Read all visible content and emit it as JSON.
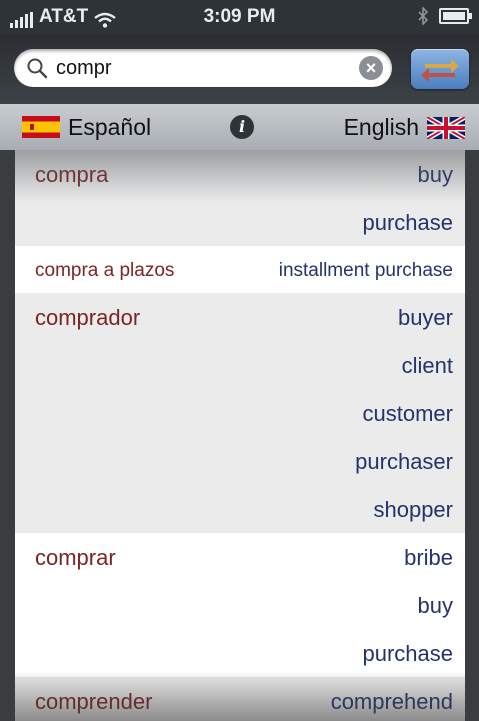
{
  "status_bar": {
    "carrier": "AT&T",
    "time": "3:09 PM"
  },
  "search": {
    "query": "compr"
  },
  "language_bar": {
    "source_language": "Español",
    "target_language": "English"
  },
  "colors": {
    "spanish_word": "#7b2424",
    "english_word": "#26326e",
    "swap_button": "#4b7fc0"
  },
  "results": [
    {
      "es": "compra",
      "en": "buy",
      "shade": "alt"
    },
    {
      "es": "",
      "en": "purchase",
      "shade": "alt"
    },
    {
      "es": "compra a plazos",
      "en": "installment purchase",
      "shade": "plain",
      "compact": true
    },
    {
      "es": "comprador",
      "en": "buyer",
      "shade": "alt"
    },
    {
      "es": "",
      "en": "client",
      "shade": "alt"
    },
    {
      "es": "",
      "en": "customer",
      "shade": "alt"
    },
    {
      "es": "",
      "en": "purchaser",
      "shade": "alt"
    },
    {
      "es": "",
      "en": "shopper",
      "shade": "alt"
    },
    {
      "es": "comprar",
      "en": "bribe",
      "shade": "plain"
    },
    {
      "es": "",
      "en": "buy",
      "shade": "plain"
    },
    {
      "es": "",
      "en": "purchase",
      "shade": "plain"
    },
    {
      "es": "comprender",
      "en": "comprehend",
      "shade": "alt"
    }
  ]
}
